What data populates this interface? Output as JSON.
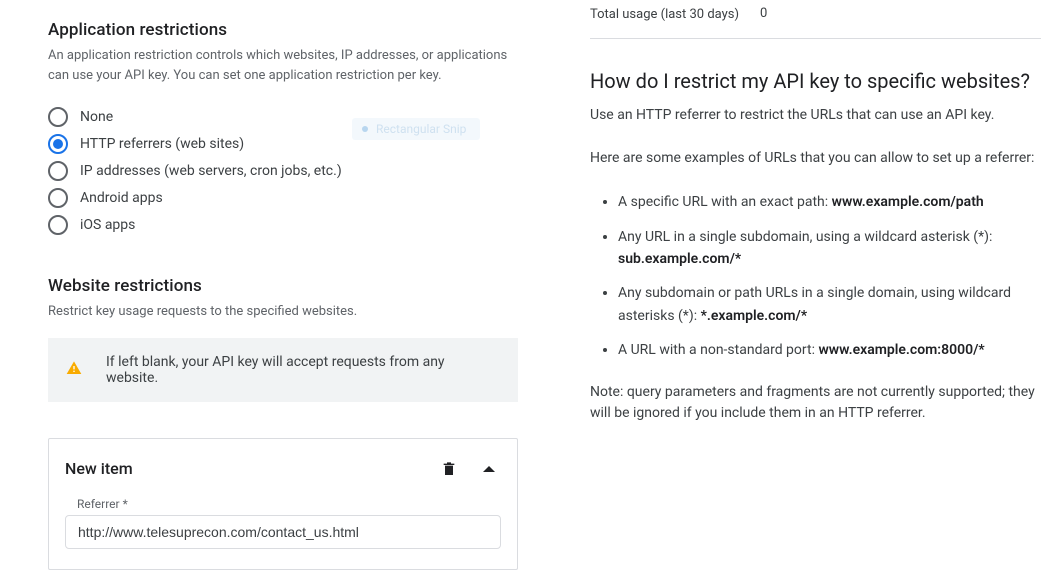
{
  "left": {
    "app_restrictions": {
      "title": "Application restrictions",
      "description": "An application restriction controls which websites, IP addresses, or applications can use your API key. You can set one application restriction per key.",
      "options": [
        "None",
        "HTTP referrers (web sites)",
        "IP addresses (web servers, cron jobs, etc.)",
        "Android apps",
        "iOS apps"
      ],
      "selected_index": 1
    },
    "website_restrictions": {
      "title": "Website restrictions",
      "subtitle": "Restrict key usage requests to the specified websites.",
      "banner": "If left blank, your API key will accept requests from any website."
    },
    "new_item": {
      "title": "New item",
      "field_label": "Referrer *",
      "field_value": "http://www.telesuprecon.com/contact_us.html"
    },
    "ghost_chip": "Rectangular Snip"
  },
  "right": {
    "usage": {
      "label": "Total usage (last 30 days)",
      "value": "0"
    },
    "help": {
      "title": "How do I restrict my API key to specific websites?",
      "p1": "Use an HTTP referrer to restrict the URLs that can use an API key.",
      "p2": "Here are some examples of URLs that you can allow to set up a referrer:",
      "items": [
        {
          "pre": "A specific URL with an exact path: ",
          "bold": "www.example.com/path"
        },
        {
          "pre": "Any URL in a single subdomain, using a wildcard asterisk (*): ",
          "bold": "sub.example.com/*"
        },
        {
          "pre": "Any subdomain or path URLs in a single domain, using wildcard asterisks (*): ",
          "bold": "*.example.com/*"
        },
        {
          "pre": "A URL with a non-standard port: ",
          "bold": "www.example.com:8000/*"
        }
      ],
      "note": "Note: query parameters and fragments are not currently supported; they will be ignored if you include them in an HTTP referrer."
    }
  }
}
